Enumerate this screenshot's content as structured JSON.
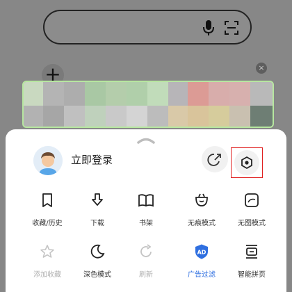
{
  "login": {
    "label": "立即登录"
  },
  "menu_row1": [
    {
      "label": "收藏/历史",
      "icon": "bookmark-icon"
    },
    {
      "label": "下载",
      "icon": "download-icon"
    },
    {
      "label": "书架",
      "icon": "bookshelf-icon"
    },
    {
      "label": "无痕模式",
      "icon": "incognito-icon"
    },
    {
      "label": "无图模式",
      "icon": "no-image-icon"
    }
  ],
  "menu_row2": [
    {
      "label": "添加收藏",
      "icon": "star-icon",
      "disabled": true
    },
    {
      "label": "深色模式",
      "icon": "moon-icon"
    },
    {
      "label": "刷新",
      "icon": "refresh-icon",
      "disabled": true
    },
    {
      "label": "广告过滤",
      "icon": "ad-filter-icon",
      "active": true,
      "badge": "AD"
    },
    {
      "label": "智能拼页",
      "icon": "smart-page-icon"
    }
  ],
  "colors": {
    "accent": "#2f6fe0",
    "highlight_border": "#e02020",
    "banner_border": "#b7e7a0"
  }
}
